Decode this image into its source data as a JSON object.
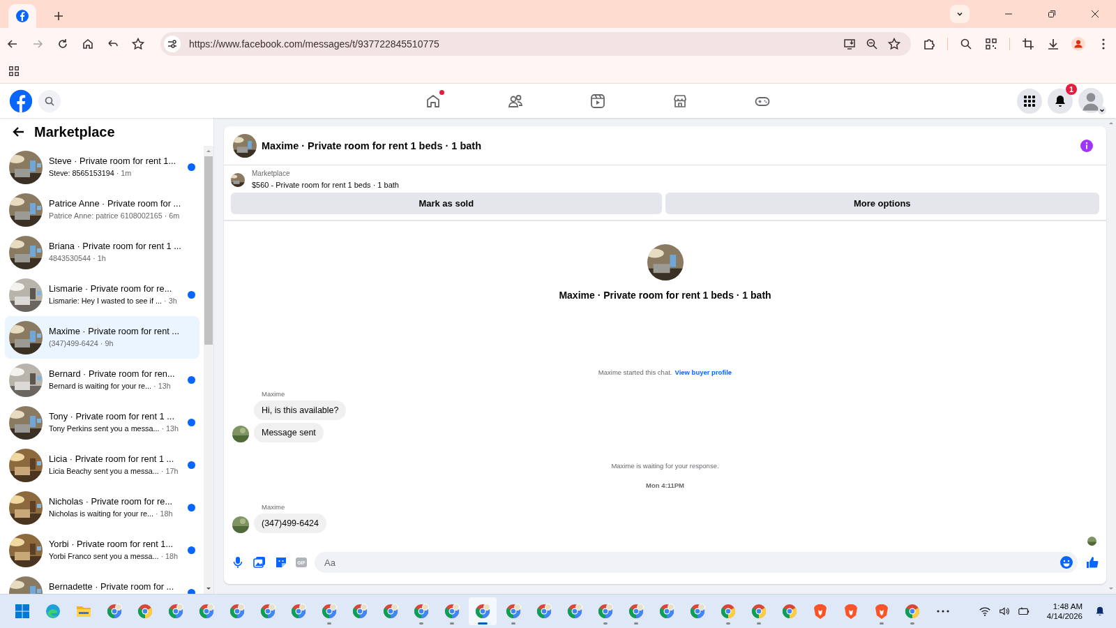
{
  "browser": {
    "url": "https://www.facebook.com/messages/t/937722845510775"
  },
  "header": {
    "notifications": "1"
  },
  "sidebar": {
    "title": "Marketplace",
    "conversations": [
      {
        "title": "Steve · Private room for rent 1...",
        "preview": "Steve: 8565153194",
        "time": "· 1m",
        "unread": true,
        "selected": false
      },
      {
        "title": "Patrice Anne · Private room for ...",
        "preview": "Patrice Anne: patrice 6108002165",
        "time": "· 6m",
        "unread": false,
        "selected": false
      },
      {
        "title": "Briana · Private room for rent 1 ...",
        "preview": "4843530544",
        "time": "· 1h",
        "unread": false,
        "selected": false
      },
      {
        "title": "Lismarie · Private room for re...",
        "preview": "Lismarie: Hey I wasted to see if ...",
        "time": "· 3h",
        "unread": true,
        "selected": false
      },
      {
        "title": "Maxime · Private room for rent ...",
        "preview": "(347)499-6424",
        "time": "· 9h",
        "unread": false,
        "selected": true
      },
      {
        "title": "Bernard · Private room for ren...",
        "preview": "Bernard is waiting for your re...",
        "time": "· 13h",
        "unread": true,
        "selected": false
      },
      {
        "title": "Tony · Private room for rent 1 ...",
        "preview": "Tony Perkins sent you a messa...",
        "time": "· 13h",
        "unread": true,
        "selected": false
      },
      {
        "title": "Licia · Private room for rent 1 ...",
        "preview": "Licia Beachy sent you a messa...",
        "time": "· 17h",
        "unread": true,
        "selected": false
      },
      {
        "title": "Nicholas · Private room for re...",
        "preview": "Nicholas is waiting for your re...",
        "time": "· 18h",
        "unread": true,
        "selected": false
      },
      {
        "title": "Yorbi · Private room for rent 1...",
        "preview": "Yorbi Franco sent you a messa...",
        "time": "· 18h",
        "unread": true,
        "selected": false
      },
      {
        "title": "Bernadette · Private room for ...",
        "unread": true,
        "selected": false
      }
    ]
  },
  "chat": {
    "title": "Maxime · Private room for rent 1 beds · 1 bath",
    "listing": {
      "source": "Marketplace",
      "text": "$560 - Private room for rent 1 beds · 1 bath"
    },
    "actions": [
      "Mark as sold",
      "More options"
    ],
    "intro_title": "Maxime · Private room for rent 1 beds · 1 bath",
    "messages": [
      {
        "kind": "notice",
        "text": "Maxime started this chat.",
        "link": "View buyer profile"
      },
      {
        "kind": "sender",
        "text": "Maxime"
      },
      {
        "kind": "bubble",
        "text": "Hi, is this available?",
        "avatar": false
      },
      {
        "kind": "bubble",
        "text": "Message sent",
        "avatar": true
      },
      {
        "kind": "notice",
        "text": "Maxime is waiting for your response."
      },
      {
        "kind": "time",
        "text": "Mon 4:11PM"
      },
      {
        "kind": "sender",
        "text": "Maxime"
      },
      {
        "kind": "bubble",
        "text": "(347)499-6424",
        "avatar": true
      }
    ],
    "composer": {
      "gif": "GIF",
      "placeholder": "Aa"
    }
  },
  "taskbar": {
    "apps": [
      {
        "kind": "windows",
        "running": false,
        "selected": false
      },
      {
        "kind": "edge",
        "running": false,
        "selected": false
      },
      {
        "kind": "folder",
        "running": false,
        "selected": false
      },
      {
        "kind": "profile",
        "running": false,
        "selected": false
      },
      {
        "kind": "chrome",
        "running": false,
        "selected": false
      },
      {
        "kind": "profile",
        "running": false,
        "selected": false
      },
      {
        "kind": "profile",
        "running": false,
        "selected": false
      },
      {
        "kind": "profile",
        "running": false,
        "selected": false
      },
      {
        "kind": "profile",
        "running": false,
        "selected": false
      },
      {
        "kind": "profile",
        "running": false,
        "selected": false
      },
      {
        "kind": "profile",
        "running": true,
        "selected": false
      },
      {
        "kind": "profile",
        "running": false,
        "selected": false
      },
      {
        "kind": "profile",
        "running": false,
        "selected": false
      },
      {
        "kind": "profile",
        "running": true,
        "selected": false
      },
      {
        "kind": "profile",
        "running": true,
        "selected": false
      },
      {
        "kind": "profile",
        "running": true,
        "selected": true
      },
      {
        "kind": "profile",
        "running": true,
        "selected": false
      },
      {
        "kind": "profile",
        "running": false,
        "selected": false
      },
      {
        "kind": "profile",
        "running": false,
        "selected": false
      },
      {
        "kind": "profile",
        "running": true,
        "selected": false
      },
      {
        "kind": "profile",
        "running": true,
        "selected": false
      },
      {
        "kind": "profile",
        "running": false,
        "selected": false
      },
      {
        "kind": "profile",
        "running": false,
        "selected": false
      },
      {
        "kind": "chrome",
        "running": true,
        "selected": false
      },
      {
        "kind": "chrome",
        "running": true,
        "selected": false
      },
      {
        "kind": "chrome",
        "running": false,
        "selected": false
      },
      {
        "kind": "brave",
        "running": false,
        "selected": false
      },
      {
        "kind": "brave",
        "running": false,
        "selected": false
      },
      {
        "kind": "brave",
        "running": true,
        "selected": false
      },
      {
        "kind": "chrome",
        "running": true,
        "selected": false
      },
      {
        "kind": "more",
        "running": false,
        "selected": false
      }
    ],
    "time": "1:48 AM",
    "date": "4/14/2026"
  }
}
